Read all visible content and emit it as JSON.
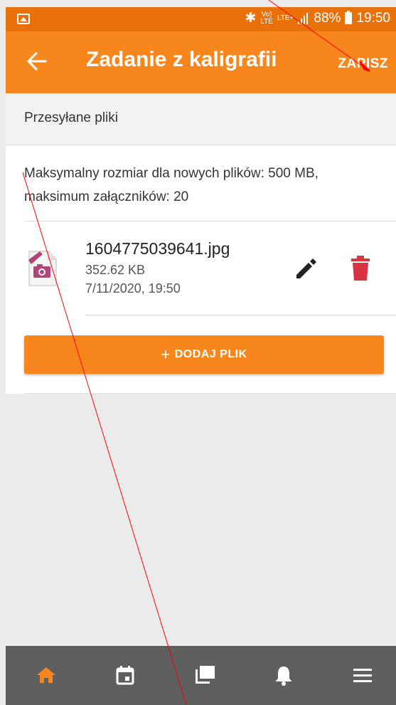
{
  "status_bar": {
    "volte": "Vo)",
    "lte": "LTE",
    "lte_plus": "LTE+",
    "battery": "88%",
    "time": "19:50"
  },
  "app_bar": {
    "title": "Zadanie z kaligrafii",
    "save_label": "ZAPISZ",
    "back_icon": "arrow-left-icon"
  },
  "section": {
    "title": "Przesyłane pliki"
  },
  "info": {
    "text": "Maksymalny rozmiar dla nowych plików: 500 MB, maksimum załączników: 20"
  },
  "files": [
    {
      "name": "1604775039641.jpg",
      "size": "352.62 KB",
      "date": "7/11/2020, 19:50"
    }
  ],
  "add_button": {
    "plus": "+",
    "label": "DODAJ PLIK"
  },
  "bottom_nav": [
    {
      "icon": "home-icon",
      "active": true
    },
    {
      "icon": "calendar-icon",
      "active": false
    },
    {
      "icon": "messages-icon",
      "active": false
    },
    {
      "icon": "bell-icon",
      "active": false
    },
    {
      "icon": "menu-icon",
      "active": false
    }
  ],
  "colors": {
    "accent": "#f7861c",
    "status_bar": "#e8710c",
    "delete": "#d93240",
    "nav_bg": "#5f5f5f",
    "nav_active": "#f7861c",
    "annotation": "#ff0000"
  }
}
